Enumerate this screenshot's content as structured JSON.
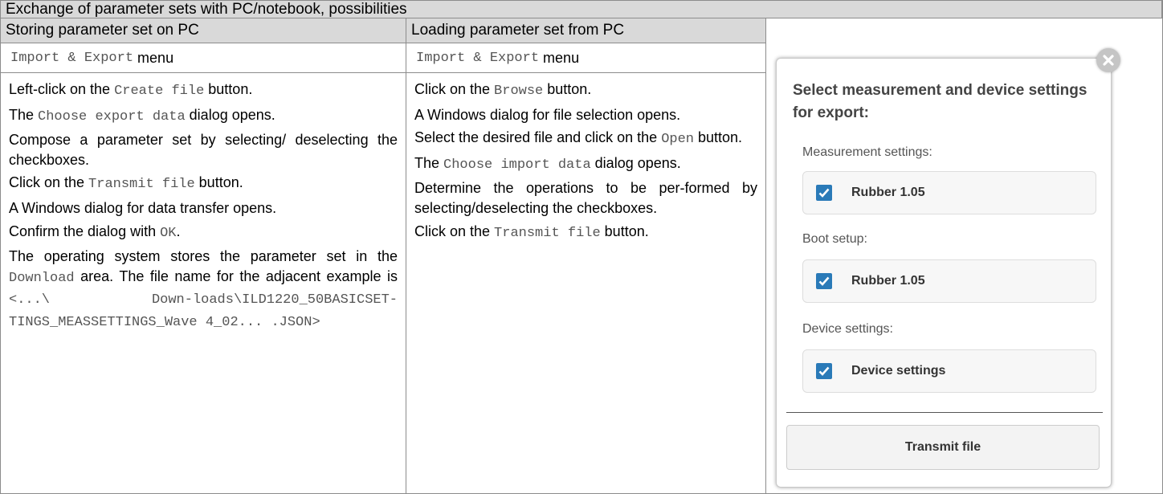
{
  "table": {
    "title": "Exchange of parameter sets with PC/notebook, possibilities",
    "col1": {
      "heading": "Storing parameter set on PC",
      "menu_code": "Import & Export",
      "menu_word": "menu",
      "lines": [
        {
          "parts": [
            {
              "t": "Left-click on the "
            },
            {
              "t": "Create file",
              "code": true
            },
            {
              "t": " button."
            }
          ]
        },
        {
          "parts": [
            {
              "t": "The "
            },
            {
              "t": "Choose export data",
              "code": true
            },
            {
              "t": " dialog opens."
            }
          ]
        },
        {
          "parts": [
            {
              "t": "Compose a parameter set by selecting/ deselecting the checkboxes."
            }
          ]
        },
        {
          "parts": [
            {
              "t": "Click on the "
            },
            {
              "t": "Transmit file",
              "code": true
            },
            {
              "t": " button."
            }
          ]
        },
        {
          "parts": [
            {
              "t": "A Windows dialog for data transfer opens."
            }
          ]
        },
        {
          "parts": [
            {
              "t": "Confirm the dialog with "
            },
            {
              "t": "OK",
              "code": true
            },
            {
              "t": "."
            }
          ]
        },
        {
          "parts": [
            {
              "t": "The operating system stores the parameter set in the "
            },
            {
              "t": "Download",
              "code": true
            },
            {
              "t": " area. The file name for the adjacent example is "
            },
            {
              "t": "<...\\ Down-loads\\ILD1220_50BASICSET-TINGS_MEASSETTINGS_Wave 4_02... .JSON>",
              "code": true
            }
          ]
        }
      ]
    },
    "col2": {
      "heading": "Loading parameter set from PC",
      "menu_code": "Import & Export",
      "menu_word": "menu",
      "lines": [
        {
          "parts": [
            {
              "t": "Click on the "
            },
            {
              "t": "Browse",
              "code": true
            },
            {
              "t": " button."
            }
          ]
        },
        {
          "parts": [
            {
              "t": "A Windows dialog for file selection opens."
            }
          ]
        },
        {
          "parts": [
            {
              "t": "Select the desired file and click on the "
            },
            {
              "t": "Open",
              "code": true
            },
            {
              "t": " button."
            }
          ]
        },
        {
          "parts": [
            {
              "t": "The "
            },
            {
              "t": "Choose import data",
              "code": true
            },
            {
              "t": " dialog opens."
            }
          ]
        },
        {
          "parts": [
            {
              "t": "Determine the operations to be per-formed by selecting/deselecting the checkboxes."
            }
          ]
        },
        {
          "parts": [
            {
              "t": "Click on the "
            },
            {
              "t": "Transmit file",
              "code": true
            },
            {
              "t": " button."
            }
          ]
        }
      ]
    }
  },
  "dialog": {
    "title": "Select measurement and device settings for export:",
    "groups": [
      {
        "label": "Measurement settings:",
        "item": "Rubber 1.05",
        "checked": true
      },
      {
        "label": "Boot setup:",
        "item": "Rubber 1.05",
        "checked": true
      },
      {
        "label": "Device settings:",
        "item": "Device settings",
        "checked": true
      }
    ],
    "transmit_label": "Transmit file",
    "checkbox_color": "#2a7ab8"
  }
}
